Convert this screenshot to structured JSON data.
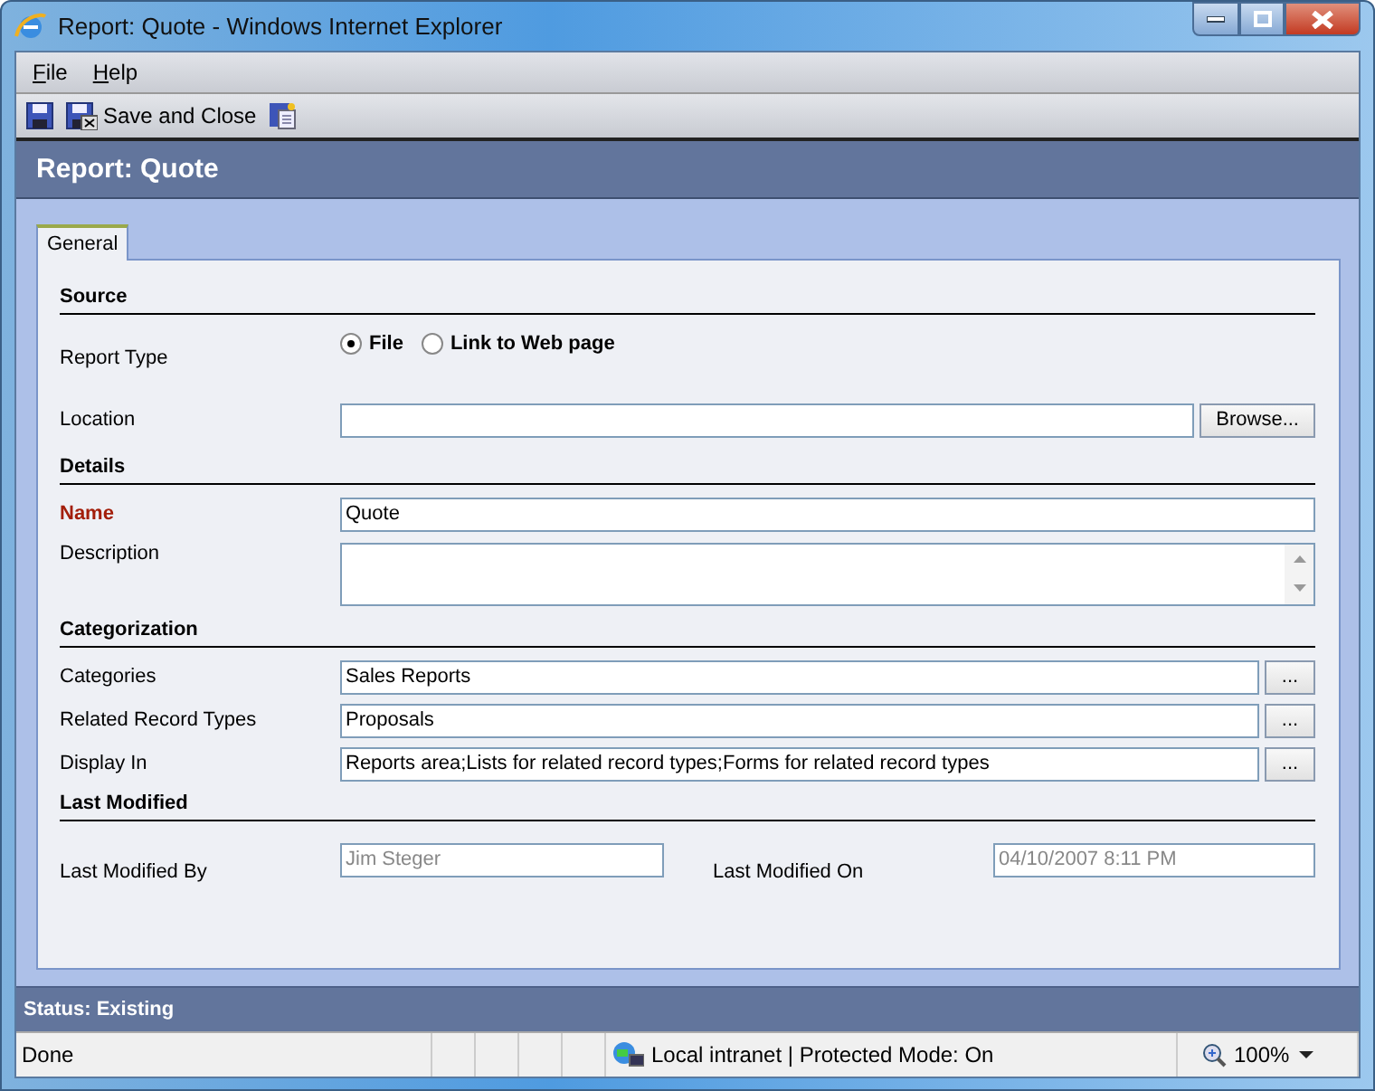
{
  "window": {
    "title": "Report: Quote - Windows Internet Explorer"
  },
  "menu": [
    {
      "label": "File"
    },
    {
      "label": "Help"
    }
  ],
  "toolbar": [
    {
      "kind": "save"
    },
    {
      "kind": "save_close",
      "label": "Save and Close"
    },
    {
      "kind": "save_new"
    }
  ],
  "header": {
    "title": "Report: Quote"
  },
  "tabs": [
    {
      "label": "General",
      "selected": true
    }
  ],
  "sections": [
    {
      "title": "Source",
      "rows": [
        {
          "kind": "radio",
          "label": "Report Type",
          "required": false,
          "options": [
            {
              "label": "File",
              "selected": true
            },
            {
              "label": "Link to Web page",
              "selected": false
            }
          ]
        },
        {
          "kind": "file",
          "label": "Location",
          "required": false,
          "button": "Browse..."
        }
      ]
    },
    {
      "title": "Details",
      "rows": [
        {
          "kind": "text",
          "label": "Name",
          "required": true,
          "value": "Quote"
        },
        {
          "kind": "textarea",
          "label": "Description",
          "required": false
        }
      ]
    },
    {
      "title": "Categorization",
      "rows": [
        {
          "kind": "lookup",
          "label": "Categories",
          "required": false,
          "value": "Sales Reports",
          "button": "..."
        },
        {
          "kind": "lookup",
          "label": "Related Record Types",
          "required": false,
          "value": "Proposals",
          "button": "..."
        },
        {
          "kind": "lookup",
          "label": "Display In",
          "required": false,
          "value": "Reports area;Lists for related record types;Forms for related record types",
          "button": "..."
        }
      ]
    },
    {
      "title": "Last Modified",
      "rows": [
        {
          "kind": "pair",
          "fields": [
            {
              "label": "Last Modified By",
              "value": "Jim Steger",
              "disabled": true
            },
            {
              "label": "Last Modified On",
              "value": "04/10/2007 8:11 PM",
              "disabled": true
            }
          ]
        }
      ]
    }
  ],
  "record_status": "Status: Existing",
  "status_bar": {
    "text": "Done",
    "zone": "Local intranet | Protected Mode: On",
    "zoom": "100%"
  }
}
